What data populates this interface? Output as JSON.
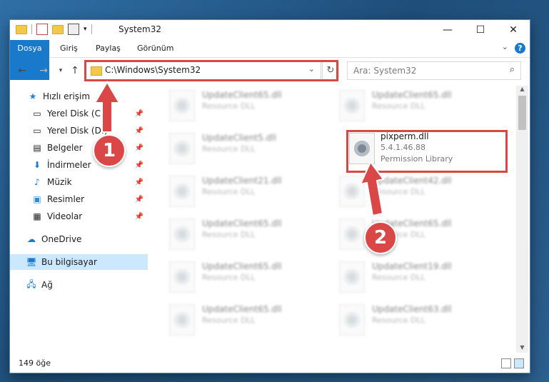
{
  "window": {
    "title": "System32"
  },
  "ribbon": {
    "tabs": [
      "Dosya",
      "Giriş",
      "Paylaş",
      "Görünüm"
    ],
    "help": "?"
  },
  "address": {
    "path": "C:\\Windows\\System32"
  },
  "search": {
    "placeholder": "Ara: System32"
  },
  "navpane": {
    "quick_access": "Hızlı erişim",
    "items": [
      {
        "label": "Yerel Disk (C:)",
        "icon": "drive-icon"
      },
      {
        "label": "Yerel Disk (D:)",
        "icon": "drive-icon"
      },
      {
        "label": "Belgeler",
        "icon": "documents-icon"
      },
      {
        "label": "İndirmeler",
        "icon": "download-icon"
      },
      {
        "label": "Müzik",
        "icon": "music-icon"
      },
      {
        "label": "Resimler",
        "icon": "pictures-icon"
      },
      {
        "label": "Videolar",
        "icon": "video-icon"
      }
    ],
    "onedrive": "OneDrive",
    "this_pc": "Bu bilgisayar",
    "network": "Ağ"
  },
  "files": {
    "left": [
      {
        "name": "UpdateClient65.dll",
        "desc": "Resource DLL"
      },
      {
        "name": "UpdateClient5.dll",
        "desc": "Resource DLL"
      },
      {
        "name": "UpdateClient21.dll",
        "desc": "Resource DLL"
      },
      {
        "name": "UpdateClient65.dll",
        "desc": "Resource DLL"
      },
      {
        "name": "UpdateClient65.dll",
        "desc": "Resource DLL"
      },
      {
        "name": "UpdateClient65.dll",
        "desc": "Resource DLL"
      }
    ],
    "right": [
      {
        "name": "UpdateClient65.dll",
        "desc": "Resource DLL"
      },
      {
        "name": "UpdateClient42.dll",
        "desc": "Resource DLL"
      },
      {
        "name": "UpdateClient65.dll",
        "desc": "Resource DLL"
      },
      {
        "name": "UpdateClient19.dll",
        "desc": "Resource DLL"
      },
      {
        "name": "UpdateClient63.dll",
        "desc": "Resource DLL"
      }
    ],
    "highlight": {
      "name": "pixperm.dll",
      "version": "5.4.1.46.88",
      "desc": "Permission Library"
    }
  },
  "status": {
    "count": "149 öğe"
  },
  "callouts": {
    "one": "1",
    "two": "2",
    "color": "#d94747"
  }
}
